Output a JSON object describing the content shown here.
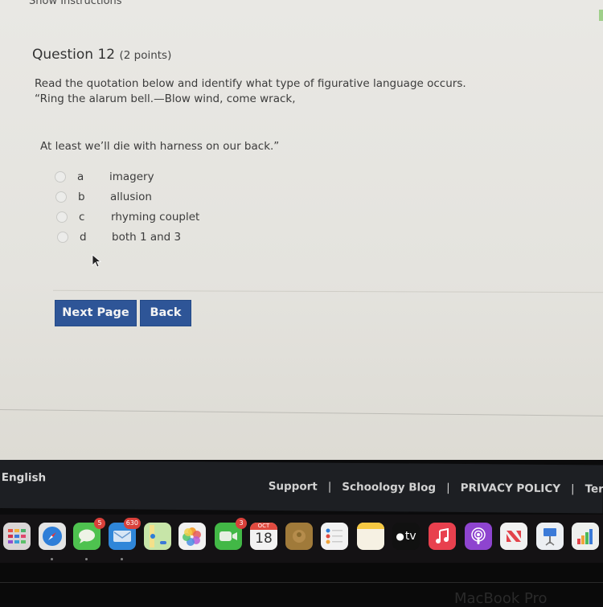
{
  "page": {
    "show_instructions": "Show Instructions",
    "question": {
      "title": "Question 12",
      "points": "(2 points)",
      "prompt_line1": "Read the quotation below and identify what type of figurative language occurs.",
      "prompt_line2": "“Ring the alarum bell.—Blow wind, come wrack,",
      "quote_end": "At least we’ll die with harness on our back.”",
      "options": [
        {
          "letter": "a",
          "text": "imagery"
        },
        {
          "letter": "b",
          "text": "allusion"
        },
        {
          "letter": "c",
          "text": "rhyming couplet"
        },
        {
          "letter": "d",
          "text": "both 1 and 3"
        }
      ]
    },
    "buttons": {
      "next": "Next Page",
      "back": "Back"
    }
  },
  "footer": {
    "language": "English",
    "links": [
      "Support",
      "Schoology Blog",
      "PRIVACY POLICY",
      "Terms"
    ],
    "separator": "|"
  },
  "dock": {
    "apps": [
      {
        "name": "launchpad"
      },
      {
        "name": "safari"
      },
      {
        "name": "messages",
        "badge": "5"
      },
      {
        "name": "mail",
        "badge": "630"
      },
      {
        "name": "maps"
      },
      {
        "name": "photos"
      },
      {
        "name": "facetime",
        "badge": "3"
      },
      {
        "name": "calendar",
        "month": "OCT",
        "day": "18"
      },
      {
        "name": "contacts"
      },
      {
        "name": "reminders"
      },
      {
        "name": "notes"
      },
      {
        "name": "apple-tv",
        "label": "tv"
      },
      {
        "name": "music"
      },
      {
        "name": "podcasts"
      },
      {
        "name": "news"
      },
      {
        "name": "keynote"
      },
      {
        "name": "numbers"
      }
    ]
  },
  "device": {
    "brand": "MacBook Pro"
  },
  "colors": {
    "button": "#2e5597",
    "footer": "#1d1f23",
    "badge": "#d9403a"
  }
}
